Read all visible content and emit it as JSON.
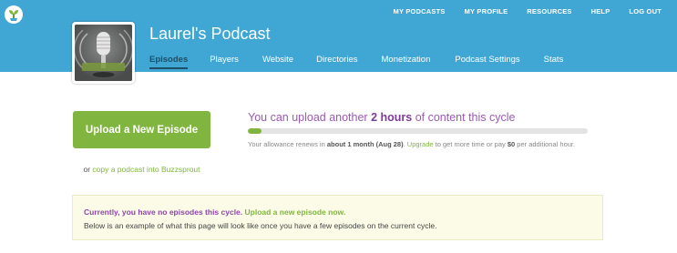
{
  "top_nav": [
    "MY PODCASTS",
    "MY PROFILE",
    "RESOURCES",
    "HELP",
    "LOG OUT"
  ],
  "podcast": {
    "title": "Laurel's Podcast"
  },
  "tabs": [
    {
      "label": "Episodes",
      "active": true
    },
    {
      "label": "Players",
      "active": false
    },
    {
      "label": "Website",
      "active": false
    },
    {
      "label": "Directories",
      "active": false
    },
    {
      "label": "Monetization",
      "active": false
    },
    {
      "label": "Podcast Settings",
      "active": false
    },
    {
      "label": "Stats",
      "active": false
    }
  ],
  "upload": {
    "button_label": "Upload a New Episode",
    "copy_prefix": "or ",
    "copy_link": "copy a podcast into Buzzsprout"
  },
  "quota": {
    "prefix": "You can upload another ",
    "amount": "2 hours",
    "suffix": " of content this cycle",
    "used_fraction": 0.04,
    "renew_prefix": "Your allowance renews in ",
    "renew_period": "about 1 month (Aug 28)",
    "renew_mid": ". ",
    "upgrade_link": "Upgrade",
    "renew_after": " to get more time or pay ",
    "price": "$0",
    "renew_suffix": " per additional hour."
  },
  "notice": {
    "line1_text": "Currently, you have no episodes this cycle. ",
    "line1_link": "Upload a new episode now.",
    "line2": "Below is an example of what this page will look like once you have a few episodes on the current cycle."
  },
  "colors": {
    "header": "#40a6d4",
    "accent_green": "#80b63f",
    "accent_purple": "#9b59b6",
    "notice_bg": "#fbfbe7"
  },
  "icons": [
    "buzzsprout-logo-icon",
    "microphone-artwork"
  ]
}
